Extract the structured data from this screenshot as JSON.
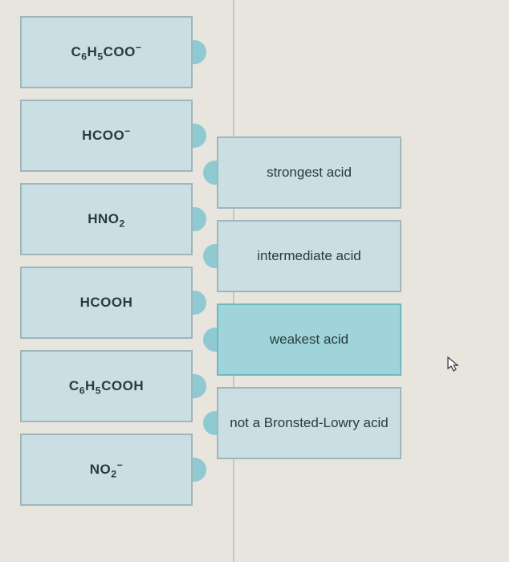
{
  "left_items": [
    {
      "label_html": "C<sub>6</sub>H<sub>5</sub>COO<sup>−</sup>",
      "plain": "C6H5COO-"
    },
    {
      "label_html": "HCOO<sup>−</sup>",
      "plain": "HCOO-"
    },
    {
      "label_html": "HNO<sub>2</sub>",
      "plain": "HNO2"
    },
    {
      "label_html": "HCOOH",
      "plain": "HCOOH"
    },
    {
      "label_html": "C<sub>6</sub>H<sub>5</sub>COOH",
      "plain": "C6H5COOH"
    },
    {
      "label_html": "NO<sub>2</sub><sup>−</sup>",
      "plain": "NO2-"
    }
  ],
  "right_items": [
    {
      "label": "strongest acid",
      "highlighted": false
    },
    {
      "label": "intermediate acid",
      "highlighted": false
    },
    {
      "label": "weakest acid",
      "highlighted": true
    },
    {
      "label": "not a Bronsted-Lowry acid",
      "highlighted": false
    }
  ],
  "colors": {
    "tile_bg": "#c9dfe3",
    "tile_border": "#9fb6bb",
    "highlight_bg": "#9fd4db",
    "connector": "#8fc9d1",
    "page_bg": "#e8e4de"
  }
}
